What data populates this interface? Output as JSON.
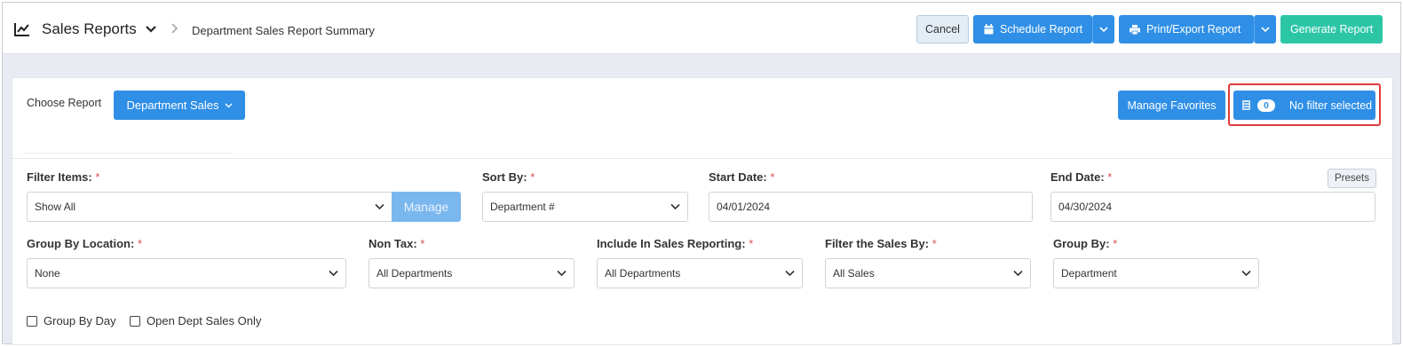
{
  "header": {
    "title": "Sales Reports",
    "breadcrumb": "Department Sales Report Summary",
    "buttons": {
      "cancel": "Cancel",
      "schedule": "Schedule Report",
      "print_export": "Print/Export Report",
      "generate": "Generate Report"
    }
  },
  "report": {
    "choose_label": "Choose Report",
    "selected_report": "Department Sales",
    "manage_favorites": "Manage Favorites",
    "filter_count": "0",
    "filter_status": "No filter selected"
  },
  "form": {
    "filter_items": {
      "label": "Filter Items:",
      "value": "Show All",
      "manage": "Manage"
    },
    "sort_by": {
      "label": "Sort By:",
      "value": "Department #"
    },
    "start_date": {
      "label": "Start Date:",
      "value": "04/01/2024"
    },
    "end_date": {
      "label": "End Date:",
      "value": "04/30/2024"
    },
    "presets": "Presets",
    "group_by_location": {
      "label": "Group By Location:",
      "value": "None"
    },
    "non_tax": {
      "label": "Non Tax:",
      "value": "All Departments"
    },
    "include_in_sales": {
      "label": "Include In Sales Reporting:",
      "value": "All Departments"
    },
    "filter_sales_by": {
      "label": "Filter the Sales By:",
      "value": "All Sales"
    },
    "group_by": {
      "label": "Group By:",
      "value": "Department"
    },
    "required_mark": "*",
    "checkboxes": {
      "group_by_day": "Group By Day",
      "open_dept_sales_only": "Open Dept Sales Only"
    }
  },
  "colors": {
    "primary": "#2f8fe6",
    "generate": "#2cc6a7",
    "highlight": "#e23b3b",
    "required": "#d9534f"
  }
}
